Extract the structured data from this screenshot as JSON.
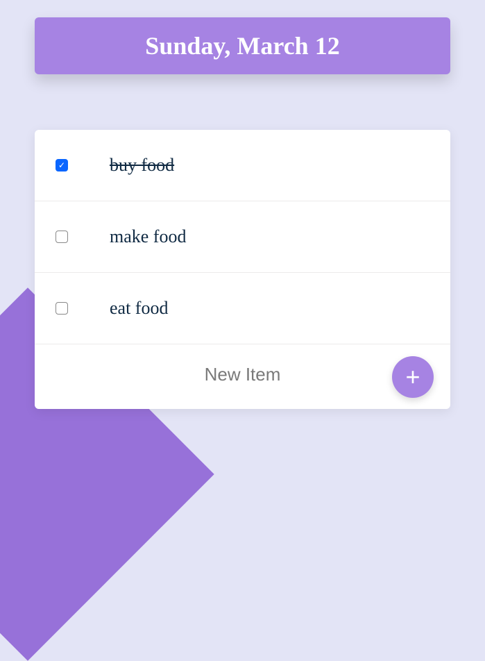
{
  "header": {
    "title": "Sunday, March 12"
  },
  "items": [
    {
      "label": "buy food",
      "checked": true
    },
    {
      "label": "make food",
      "checked": false
    },
    {
      "label": "eat food",
      "checked": false
    }
  ],
  "newItem": {
    "placeholder": "New Item"
  },
  "icons": {
    "add": "+",
    "check": "✓"
  },
  "colors": {
    "accent": "#a683e3",
    "background": "#e3e4f6",
    "checkbox_checked": "#0a66ff"
  }
}
